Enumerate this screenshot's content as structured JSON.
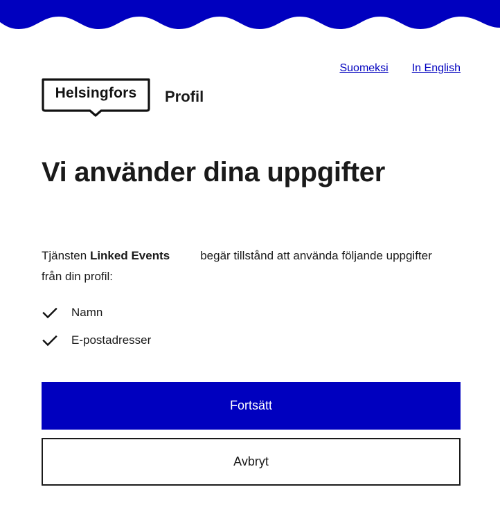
{
  "header": {
    "brand_color": "#0000bf",
    "languages": [
      {
        "label": "Suomeksi"
      },
      {
        "label": "In English"
      }
    ]
  },
  "logo": {
    "text": "Helsingfors",
    "icon": "helsinki-logo-speech-bubble"
  },
  "service": {
    "name": "Profil"
  },
  "page": {
    "title": "Vi använder dina uppgifter",
    "intro_prefix": "Tjänsten",
    "client_name": "Linked Events",
    "intro_suffix": "begär tillstånd att använda följande uppgifter från din profil:"
  },
  "permissions": [
    {
      "label": "Namn",
      "icon": "check-icon"
    },
    {
      "label": "E-postadresser",
      "icon": "check-icon"
    }
  ],
  "actions": {
    "continue_label": "Fortsätt",
    "cancel_label": "Avbryt"
  }
}
